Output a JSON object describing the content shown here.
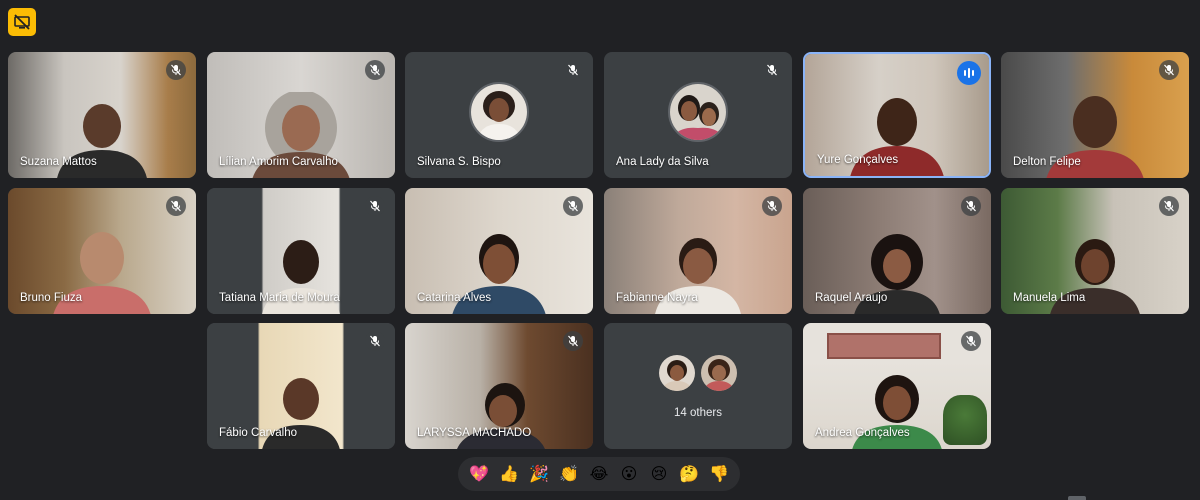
{
  "badge": {
    "icon": "screen-share-off-icon",
    "color": "#fbbc04"
  },
  "participants": [
    {
      "name": "Suzana Mattos",
      "mic": "muted"
    },
    {
      "name": "Lílian Amorim Carvalho",
      "mic": "muted"
    },
    {
      "name": "Silvana S. Bispo",
      "mic": "muted",
      "camera": "off"
    },
    {
      "name": "Ana Lady da Silva",
      "mic": "muted",
      "camera": "off"
    },
    {
      "name": "Yure Gonçalves",
      "mic": "speaking"
    },
    {
      "name": "Delton Felipe",
      "mic": "muted"
    },
    {
      "name": "Bruno Fiuza",
      "mic": "muted"
    },
    {
      "name": "Tatiana Maria de Moura",
      "mic": "muted"
    },
    {
      "name": "Catarina Alves",
      "mic": "muted"
    },
    {
      "name": "Fabianne Nayra",
      "mic": "muted"
    },
    {
      "name": "Raquel Araujo",
      "mic": "muted"
    },
    {
      "name": "Manuela Lima",
      "mic": "muted"
    },
    {
      "name": "Fábio Carvalho",
      "mic": "muted"
    },
    {
      "name": "LARYSSA MACHADO",
      "mic": "muted"
    },
    {
      "name": "Andrea Gonçalves",
      "mic": "muted"
    }
  ],
  "others": {
    "label": "14 others"
  },
  "reactions": [
    {
      "emoji": "💖",
      "name": "sparkling-heart"
    },
    {
      "emoji": "👍",
      "name": "thumbs-up"
    },
    {
      "emoji": "🎉",
      "name": "party-popper"
    },
    {
      "emoji": "👏",
      "name": "clapping"
    },
    {
      "emoji": "😂",
      "name": "tears-of-joy"
    },
    {
      "emoji": "😮",
      "name": "surprised"
    },
    {
      "emoji": "😢",
      "name": "crying"
    },
    {
      "emoji": "🤔",
      "name": "thinking"
    },
    {
      "emoji": "👎",
      "name": "thumbs-down"
    }
  ],
  "colors": {
    "background": "#202124",
    "tile": "#3c4043",
    "speaking": "#8ab4f8",
    "speak_badge": "#1a73e8"
  }
}
